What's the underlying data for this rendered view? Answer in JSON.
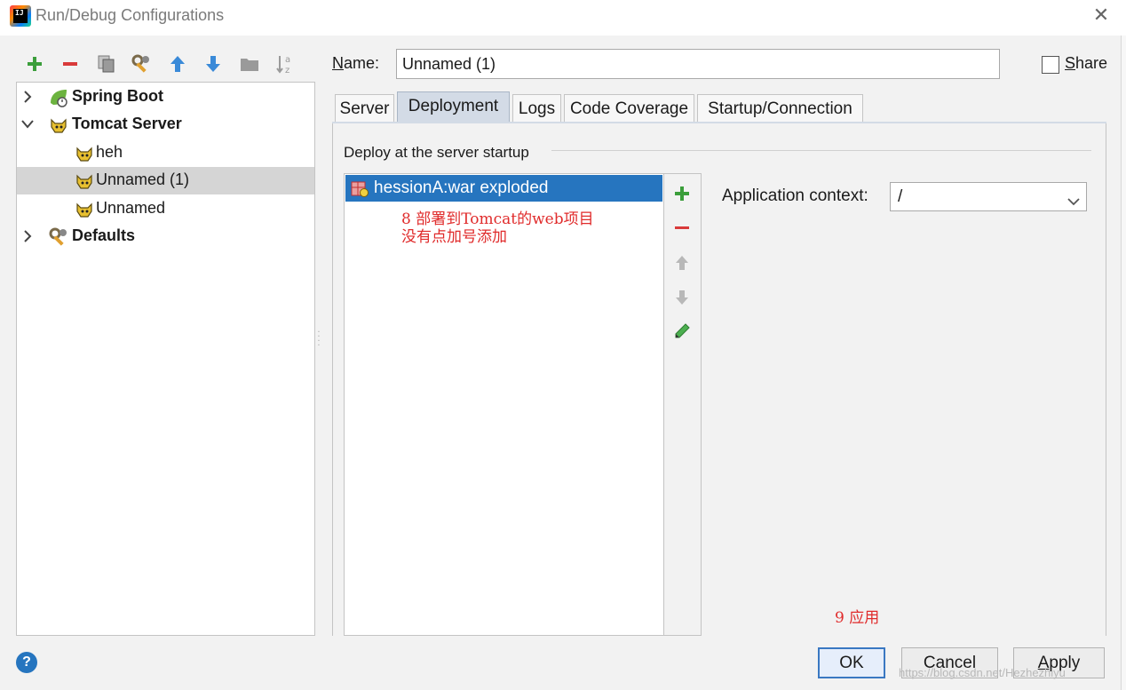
{
  "window": {
    "title": "Run/Debug Configurations",
    "app_icon_label": "IJ",
    "close_glyph": "✕"
  },
  "toolbar": {
    "icons": [
      "add-icon",
      "remove-icon",
      "copy-icon",
      "wrench-icon",
      "move-up-icon",
      "move-down-icon",
      "folder-icon",
      "sort-icon"
    ],
    "colors": {
      "add": "#3b9e3b",
      "remove": "#d93a3a",
      "arrow": "#3a8ad8",
      "grey": "#8c8c8c"
    }
  },
  "tree": {
    "items": [
      {
        "label": "Spring Boot",
        "bold": true,
        "expanded": false,
        "level": 0,
        "icon": "spring-boot-icon"
      },
      {
        "label": "Tomcat Server",
        "bold": true,
        "expanded": true,
        "level": 0,
        "icon": "tomcat-icon"
      },
      {
        "label": "heh",
        "bold": false,
        "level": 1,
        "icon": "tomcat-icon"
      },
      {
        "label": "Unnamed (1)",
        "bold": false,
        "level": 1,
        "icon": "tomcat-icon",
        "selected": true
      },
      {
        "label": "Unnamed",
        "bold": false,
        "level": 1,
        "icon": "tomcat-icon"
      },
      {
        "label": "Defaults",
        "bold": true,
        "expanded": false,
        "level": 0,
        "icon": "wrench-icon"
      }
    ]
  },
  "name": {
    "label_mnemonic": "N",
    "label_rest": "ame:",
    "value": "Unnamed (1)"
  },
  "share": {
    "mnemonic": "S",
    "label_rest": "hare",
    "checked": false
  },
  "tabs": [
    {
      "label": "Server"
    },
    {
      "label": "Deployment",
      "active": true
    },
    {
      "label": "Logs"
    },
    {
      "label": "Code Coverage"
    },
    {
      "label": "Startup/Connection"
    }
  ],
  "deployment": {
    "group_title": "Deploy at the server startup",
    "items": [
      {
        "label": "hessionA:war exploded",
        "icon": "artifact-icon"
      }
    ],
    "side_buttons": [
      "add-icon",
      "remove-icon",
      "move-up-icon",
      "move-down-icon",
      "edit-icon"
    ]
  },
  "annotations": {
    "note1_line1": "8 部署到Tomcat的web项目",
    "note1_line2": "没有点加号添加",
    "note2": "9 应用"
  },
  "app_context": {
    "label": "Application context:",
    "value": "/"
  },
  "buttons": {
    "help": "?",
    "ok": "OK",
    "cancel": "Cancel",
    "apply_mnemonic": "A",
    "apply_rest": "pply"
  },
  "watermark": "https://blog.csdn.net/Hezhezhiyu"
}
